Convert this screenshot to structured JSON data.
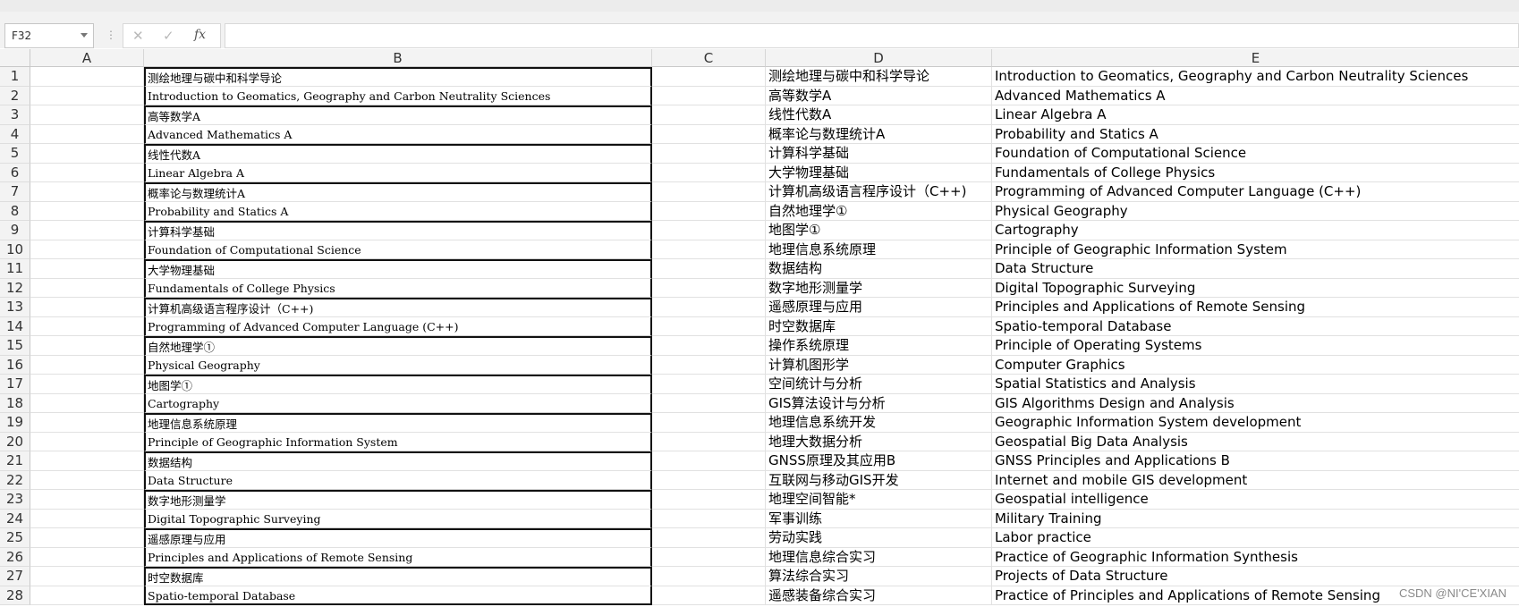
{
  "formula_bar": {
    "name_box": "F32",
    "cancel_symbol": "✕",
    "enter_symbol": "✓",
    "fx_label": "fx",
    "formula_value": ""
  },
  "columns": [
    "A",
    "B",
    "C",
    "D",
    "E"
  ],
  "rows": [
    {
      "n": "1",
      "b": "测绘地理与碳中和科学导论",
      "d": "测绘地理与碳中和科学导论",
      "e": "Introduction to Geomatics, Geography and Carbon Neutrality Sciences"
    },
    {
      "n": "2",
      "b": "Introduction to Geomatics, Geography and Carbon Neutrality Sciences",
      "d": "高等数学A",
      "e": "Advanced Mathematics A"
    },
    {
      "n": "3",
      "b": "高等数学A",
      "d": "线性代数A",
      "e": "Linear Algebra A"
    },
    {
      "n": "4",
      "b": "Advanced Mathematics A",
      "d": "概率论与数理统计A",
      "e": "Probability and Statics A"
    },
    {
      "n": "5",
      "b": "线性代数A",
      "d": "计算科学基础",
      "e": "Foundation of Computational Science"
    },
    {
      "n": "6",
      "b": "Linear Algebra A",
      "d": "大学物理基础",
      "e": "Fundamentals of College Physics"
    },
    {
      "n": "7",
      "b": "概率论与数理统计A",
      "d": "计算机高级语言程序设计（C++)",
      "e": "Programming of Advanced Computer Language (C++)"
    },
    {
      "n": "8",
      "b": "Probability and Statics A",
      "d": "自然地理学①",
      "e": "Physical Geography"
    },
    {
      "n": "9",
      "b": "计算科学基础",
      "d": "地图学①",
      "e": "Cartography"
    },
    {
      "n": "10",
      "b": "Foundation of Computational Science",
      "d": "地理信息系统原理",
      "e": "Principle of Geographic Information System"
    },
    {
      "n": "11",
      "b": "大学物理基础",
      "d": "数据结构",
      "e": "Data Structure"
    },
    {
      "n": "12",
      "b": "Fundamentals of College Physics",
      "d": "数字地形测量学",
      "e": "Digital Topographic Surveying"
    },
    {
      "n": "13",
      "b": "计算机高级语言程序设计（C++)",
      "d": "遥感原理与应用",
      "e": "Principles and Applications of Remote Sensing"
    },
    {
      "n": "14",
      "b": "Programming of Advanced Computer Language (C++)",
      "d": "时空数据库",
      "e": "Spatio-temporal Database"
    },
    {
      "n": "15",
      "b": "自然地理学①",
      "d": "操作系统原理",
      "e": "Principle of Operating Systems"
    },
    {
      "n": "16",
      "b": "Physical Geography",
      "d": "计算机图形学",
      "e": "Computer Graphics"
    },
    {
      "n": "17",
      "b": "地图学①",
      "d": "空间统计与分析",
      "e": "Spatial Statistics and Analysis"
    },
    {
      "n": "18",
      "b": "Cartography",
      "d": "GIS算法设计与分析",
      "e": "GIS Algorithms Design and Analysis"
    },
    {
      "n": "19",
      "b": "地理信息系统原理",
      "d": "地理信息系统开发",
      "e": "Geographic Information System development"
    },
    {
      "n": "20",
      "b": "Principle of Geographic Information System",
      "d": "地理大数据分析",
      "e": "Geospatial Big Data Analysis"
    },
    {
      "n": "21",
      "b": "数据结构",
      "d": "GNSS原理及其应用B",
      "e": "GNSS Principles and Applications B"
    },
    {
      "n": "22",
      "b": "Data Structure",
      "d": "互联网与移动GIS开发",
      "e": "Internet and mobile GIS development"
    },
    {
      "n": "23",
      "b": "数字地形测量学",
      "d": "地理空间智能*",
      "e": "Geospatial intelligence"
    },
    {
      "n": "24",
      "b": "Digital Topographic Surveying",
      "d": "军事训练",
      "e": "Military Training"
    },
    {
      "n": "25",
      "b": "遥感原理与应用",
      "d": "劳动实践",
      "e": "Labor practice"
    },
    {
      "n": "26",
      "b": "Principles and Applications of Remote Sensing",
      "d": "地理信息综合实习",
      "e": "Practice of Geographic Information Synthesis"
    },
    {
      "n": "27",
      "b": "时空数据库",
      "d": "算法综合实习",
      "e": "Projects of Data Structure"
    },
    {
      "n": "28",
      "b": "Spatio-temporal Database",
      "d": "遥感装备综合实习",
      "e": "Practice of Principles and Applications of Remote Sensing"
    }
  ],
  "watermark": "CSDN @NI'CE'XIAN"
}
